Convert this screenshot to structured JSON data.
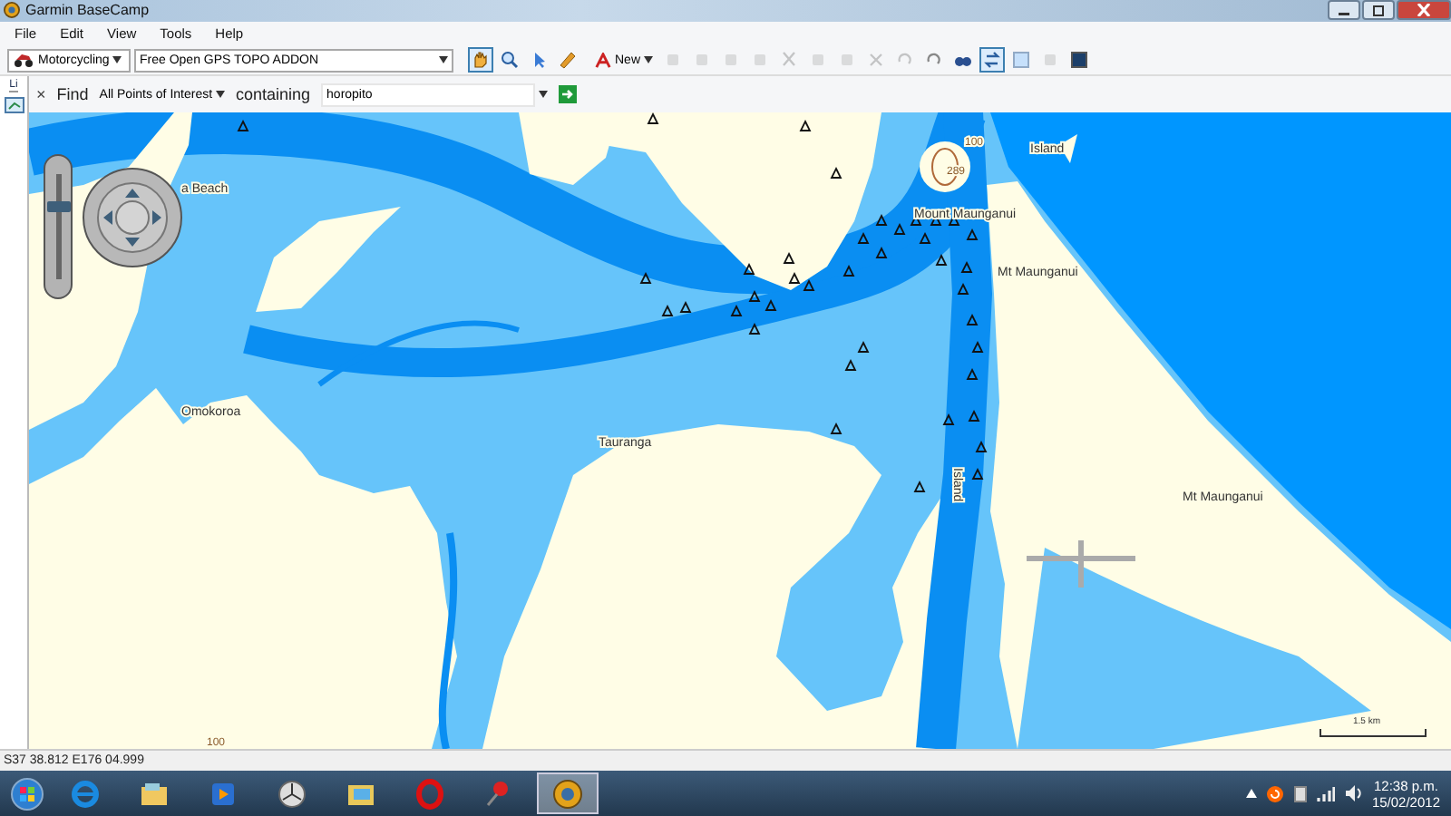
{
  "window": {
    "title": "Garmin BaseCamp"
  },
  "menu": [
    "File",
    "Edit",
    "View",
    "Tools",
    "Help"
  ],
  "toolbar": {
    "activity": "Motorcycling",
    "map_product": "Free Open GPS TOPO ADDON",
    "new_label": "New",
    "tools": [
      {
        "selected": true,
        "disabled": false
      },
      {
        "selected": false,
        "disabled": false
      },
      {
        "selected": false,
        "disabled": false
      },
      {
        "selected": false,
        "disabled": false
      },
      {
        "selected": false,
        "disabled": true
      },
      {
        "selected": false,
        "disabled": true
      },
      {
        "selected": false,
        "disabled": true
      },
      {
        "selected": false,
        "disabled": true
      },
      {
        "selected": false,
        "disabled": true
      },
      {
        "selected": false,
        "disabled": true
      },
      {
        "selected": false,
        "disabled": true
      },
      {
        "selected": false,
        "disabled": true
      },
      {
        "selected": false,
        "disabled": true
      },
      {
        "selected": false,
        "disabled": false
      },
      {
        "selected": false,
        "disabled": false
      },
      {
        "selected": true,
        "disabled": false
      },
      {
        "selected": false,
        "disabled": true
      },
      {
        "selected": false,
        "disabled": true
      },
      {
        "selected": false,
        "disabled": false
      }
    ]
  },
  "side_panel": {
    "tab": "Li"
  },
  "find": {
    "close": "×",
    "label": "Find",
    "category": "All Points of Interest",
    "connector": "containing",
    "query": "horopito"
  },
  "map": {
    "zoom": {
      "level": 0.64
    },
    "scale": "1.5 km",
    "labels": [
      {
        "text": "a Beach",
        "kind": "place"
      },
      {
        "text": "Omokoroa",
        "kind": "place"
      },
      {
        "text": "Tauranga",
        "kind": "place"
      },
      {
        "text": "Mount Maunganui",
        "kind": "place"
      },
      {
        "text": "Island",
        "kind": "place"
      },
      {
        "text": "Mt Maunganui",
        "kind": "place"
      },
      {
        "text": "Island",
        "kind": "vertical"
      },
      {
        "text": "Mt Maunganui",
        "kind": "place"
      },
      {
        "text": "289",
        "kind": "contour"
      },
      {
        "text": "100",
        "kind": "contour"
      },
      {
        "text": "100",
        "kind": "contour"
      }
    ]
  },
  "status_bar": {
    "coordinates": "S37 38.812 E176 04.999"
  },
  "taskbar": {
    "apps": [
      {
        "selected": false
      },
      {
        "selected": false
      },
      {
        "selected": false
      },
      {
        "selected": false
      },
      {
        "selected": false
      },
      {
        "selected": false
      },
      {
        "selected": false
      },
      {
        "selected": true
      }
    ],
    "time": "12:38 p.m.",
    "date": "15/02/2012"
  }
}
